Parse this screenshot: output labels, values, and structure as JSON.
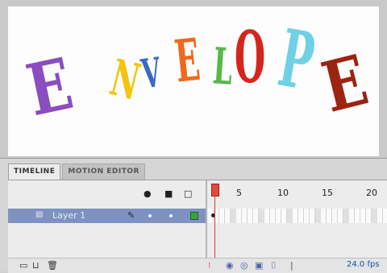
{
  "stage": {
    "letters": [
      {
        "char": "E",
        "color": "#8b4dbf"
      },
      {
        "char": "N",
        "color": "#f3c511"
      },
      {
        "char": "V",
        "color": "#3a69c5"
      },
      {
        "char": "E",
        "color": "#ee6a1f"
      },
      {
        "char": "L",
        "color": "#57b947"
      },
      {
        "char": "O",
        "color": "#d5261c"
      },
      {
        "char": "P",
        "color": "#6fd0e6"
      },
      {
        "char": "E",
        "color": "#9b2412"
      }
    ]
  },
  "tabs": {
    "timeline": "TIMELINE",
    "motion_editor": "MOTION EDITOR"
  },
  "header": {
    "eye": "eye-icon",
    "lock": "lock-icon",
    "outline": "outline-icon",
    "frame_numbers": [
      "1",
      "5",
      "10",
      "15",
      "20"
    ]
  },
  "layer": {
    "name": "Layer 1",
    "color": "#3fa33a"
  },
  "footer": {
    "fps": "24.0 fps",
    "frame_rate_value": "24.0"
  }
}
